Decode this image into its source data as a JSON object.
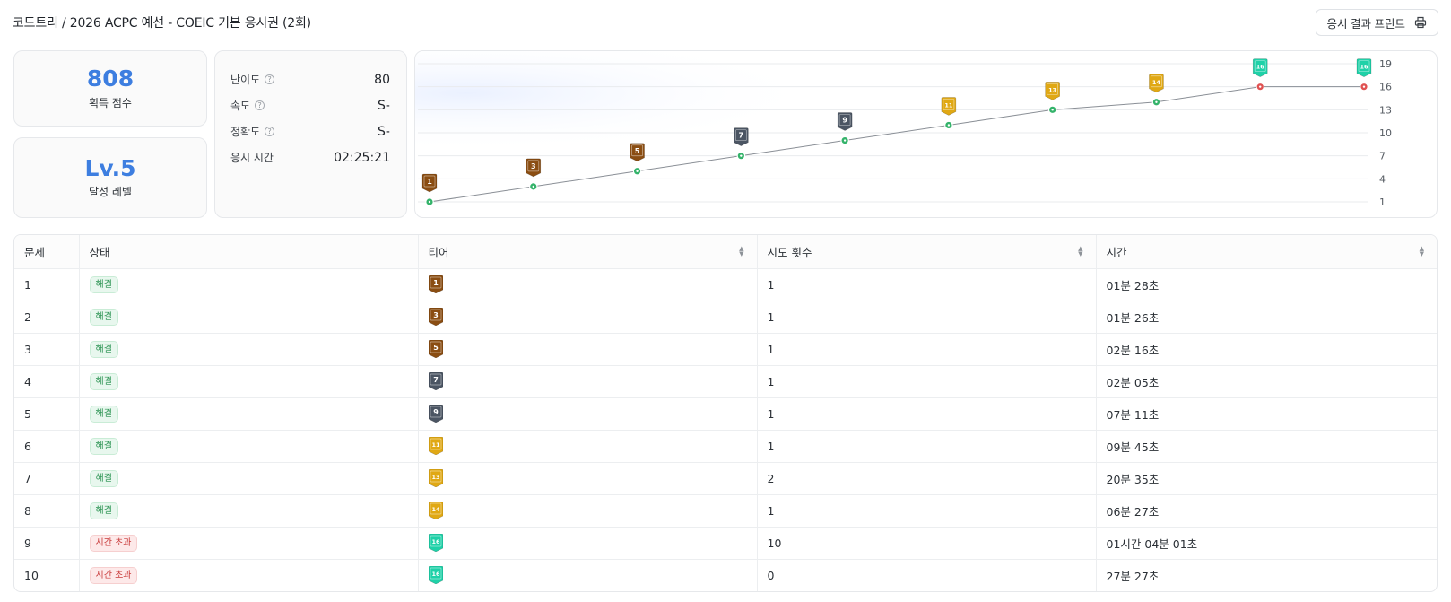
{
  "header": {
    "breadcrumb": "코드트리 / 2026 ACPC 예선 - COEIC 기본 응시권 (2회)",
    "print_label": "응시 결과 프린트"
  },
  "summary": {
    "score": "808",
    "score_label": "획득 점수",
    "level": "Lv.5",
    "level_label": "달성 레벨"
  },
  "stats": [
    {
      "label": "난이도",
      "value": "80",
      "help": true
    },
    {
      "label": "속도",
      "value": "S-",
      "help": true
    },
    {
      "label": "정확도",
      "value": "S-",
      "help": true
    },
    {
      "label": "응시 시간",
      "value": "02:25:21",
      "help": false
    }
  ],
  "tier_colors": {
    "bronze": "#8a4d12",
    "silver": "#4b5563",
    "gold": "#e0a814",
    "emerald": "#1fd1a8"
  },
  "status_colors": {
    "solved": "#34b36a",
    "timeout": "#e05252"
  },
  "chart_data": {
    "type": "line",
    "x": [
      1,
      2,
      3,
      4,
      5,
      6,
      7,
      8,
      9,
      10
    ],
    "values": [
      1,
      3,
      5,
      7,
      9,
      11,
      13,
      14,
      16,
      16
    ],
    "point_status": [
      "solved",
      "solved",
      "solved",
      "solved",
      "solved",
      "solved",
      "solved",
      "solved",
      "timeout",
      "timeout"
    ],
    "point_tier": [
      "bronze",
      "bronze",
      "bronze",
      "silver",
      "silver",
      "gold",
      "gold",
      "gold",
      "emerald",
      "emerald"
    ],
    "yticks": [
      19,
      16,
      13,
      10,
      7,
      4,
      1
    ],
    "ylim": [
      1,
      19
    ],
    "grid": true
  },
  "table": {
    "columns": [
      {
        "label": "문제",
        "sortable": false
      },
      {
        "label": "상태",
        "sortable": false
      },
      {
        "label": "티어",
        "sortable": true
      },
      {
        "label": "시도 횟수",
        "sortable": true
      },
      {
        "label": "시간",
        "sortable": true
      }
    ],
    "rows": [
      {
        "num": "1",
        "status": "해결",
        "status_type": "solved",
        "tier": "1",
        "tier_color": "bronze",
        "attempts": "1",
        "time": "01분 28초"
      },
      {
        "num": "2",
        "status": "해결",
        "status_type": "solved",
        "tier": "3",
        "tier_color": "bronze",
        "attempts": "1",
        "time": "01분 26초"
      },
      {
        "num": "3",
        "status": "해결",
        "status_type": "solved",
        "tier": "5",
        "tier_color": "bronze",
        "attempts": "1",
        "time": "02분 16초"
      },
      {
        "num": "4",
        "status": "해결",
        "status_type": "solved",
        "tier": "7",
        "tier_color": "silver",
        "attempts": "1",
        "time": "02분 05초"
      },
      {
        "num": "5",
        "status": "해결",
        "status_type": "solved",
        "tier": "9",
        "tier_color": "silver",
        "attempts": "1",
        "time": "07분 11초"
      },
      {
        "num": "6",
        "status": "해결",
        "status_type": "solved",
        "tier": "11",
        "tier_color": "gold",
        "attempts": "1",
        "time": "09분 45초"
      },
      {
        "num": "7",
        "status": "해결",
        "status_type": "solved",
        "tier": "13",
        "tier_color": "gold",
        "attempts": "2",
        "time": "20분 35초"
      },
      {
        "num": "8",
        "status": "해결",
        "status_type": "solved",
        "tier": "14",
        "tier_color": "gold",
        "attempts": "1",
        "time": "06분 27초"
      },
      {
        "num": "9",
        "status": "시간 초과",
        "status_type": "timeout",
        "tier": "16",
        "tier_color": "emerald",
        "attempts": "10",
        "time": "01시간 04분 01초"
      },
      {
        "num": "10",
        "status": "시간 초과",
        "status_type": "timeout",
        "tier": "16",
        "tier_color": "emerald",
        "attempts": "0",
        "time": "27분 27초"
      }
    ]
  }
}
